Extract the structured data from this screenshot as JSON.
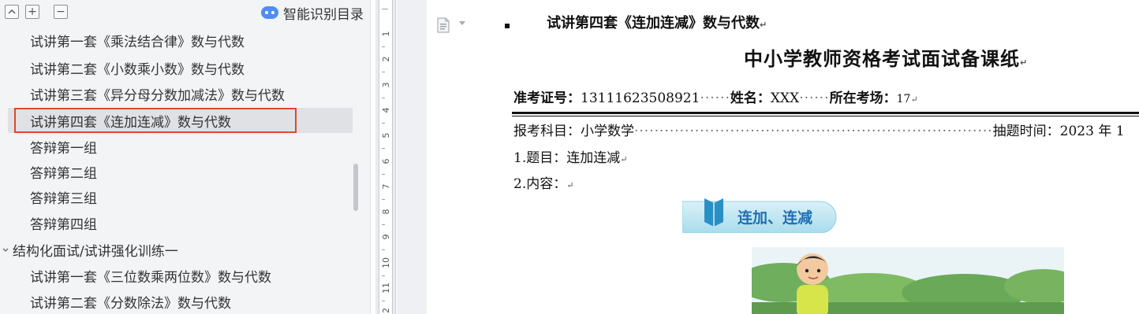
{
  "nav": {
    "toolbar": {
      "collapse_label": "⌃",
      "expand_label": "+",
      "minus_label": "−"
    },
    "smart_toc_label": "智能识别目录",
    "items": [
      {
        "label": "试讲第一套《乘法结合律》数与代数",
        "level": "sub"
      },
      {
        "label": "试讲第二套《小数乘小数》数与代数",
        "level": "sub"
      },
      {
        "label": "试讲第三套《异分母分数加减法》数与代数",
        "level": "sub"
      },
      {
        "label": "试讲第四套《连加连减》数与代数",
        "level": "sub",
        "selected": true
      },
      {
        "label": "答辩第一组",
        "level": "sub"
      },
      {
        "label": "答辩第二组",
        "level": "sub"
      },
      {
        "label": "答辩第三组",
        "level": "sub"
      },
      {
        "label": "答辩第四组",
        "level": "sub"
      },
      {
        "label": "结构化面试/试讲强化训练一",
        "level": "group"
      },
      {
        "label": "试讲第一套《三位数乘两位数》数与代数",
        "level": "sub"
      },
      {
        "label": "试讲第二套《分数除法》数与代数",
        "level": "sub"
      }
    ]
  },
  "ruler": {
    "numbers": [
      "1",
      "2",
      "3",
      "4",
      "5",
      "6",
      "7",
      "8",
      "9",
      "10",
      "11",
      "12"
    ]
  },
  "doc": {
    "heading": "试讲第四套《连加连减》数与代数",
    "title": "中小学教师资格考试面试备课纸",
    "exam_id_label": "准考证号：",
    "exam_id": "13111623508921",
    "name_label": "姓名：",
    "name": "XXX",
    "site_label": "所在考场：",
    "site": "17",
    "subject_label": "报考科目：",
    "subject": "小学数学",
    "draw_time_label": "抽题时间：",
    "draw_time": "2023 年 1",
    "q1": "1.题目：连加连减",
    "q2": "2.内容：",
    "banner_text": "连加、连减",
    "para_mark": "↵"
  },
  "colors": {
    "selection_outline": "#e0462e",
    "banner_blue": "#1f6fb2",
    "banner_bg": "#bfe6f2"
  }
}
